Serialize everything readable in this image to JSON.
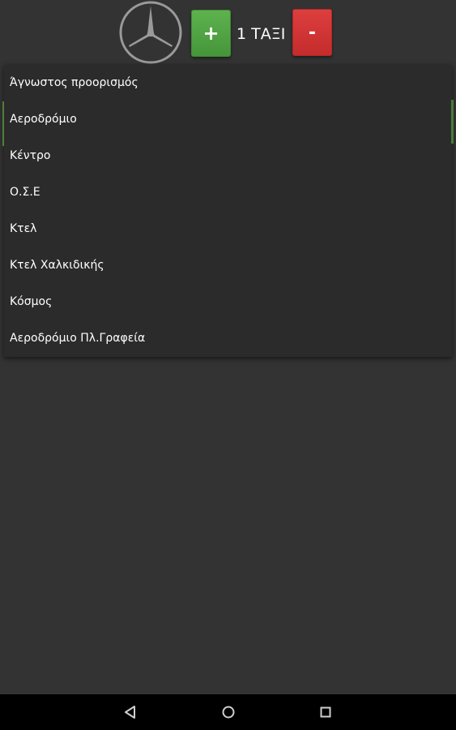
{
  "header": {
    "logo_icon": "mercedes-star-icon",
    "plus_label": "+",
    "minus_label": "-",
    "taxi_count": "1 ΤΑΞΙ",
    "plus_color": "#4fa443",
    "minus_color": "#d03535"
  },
  "dropdown": {
    "selected_index": 1,
    "items": [
      {
        "label": "Άγνωστος προορισμός"
      },
      {
        "label": "Αεροδρόμιο"
      },
      {
        "label": "Κέντρο"
      },
      {
        "label": "Ο.Σ.Ε"
      },
      {
        "label": "Κτελ"
      },
      {
        "label": "Κτελ Χαλκιδικής"
      },
      {
        "label": "Κόσμος"
      },
      {
        "label": "Αεροδρόμιο Πλ.Γραφεία"
      }
    ]
  },
  "navbar": {
    "back_icon": "back-triangle-icon",
    "home_icon": "home-circle-icon",
    "recents_icon": "recents-square-icon"
  },
  "colors": {
    "background": "#333333",
    "dropdown_bg": "#2b2b2b",
    "selection_accent": "#4f7f3e"
  }
}
